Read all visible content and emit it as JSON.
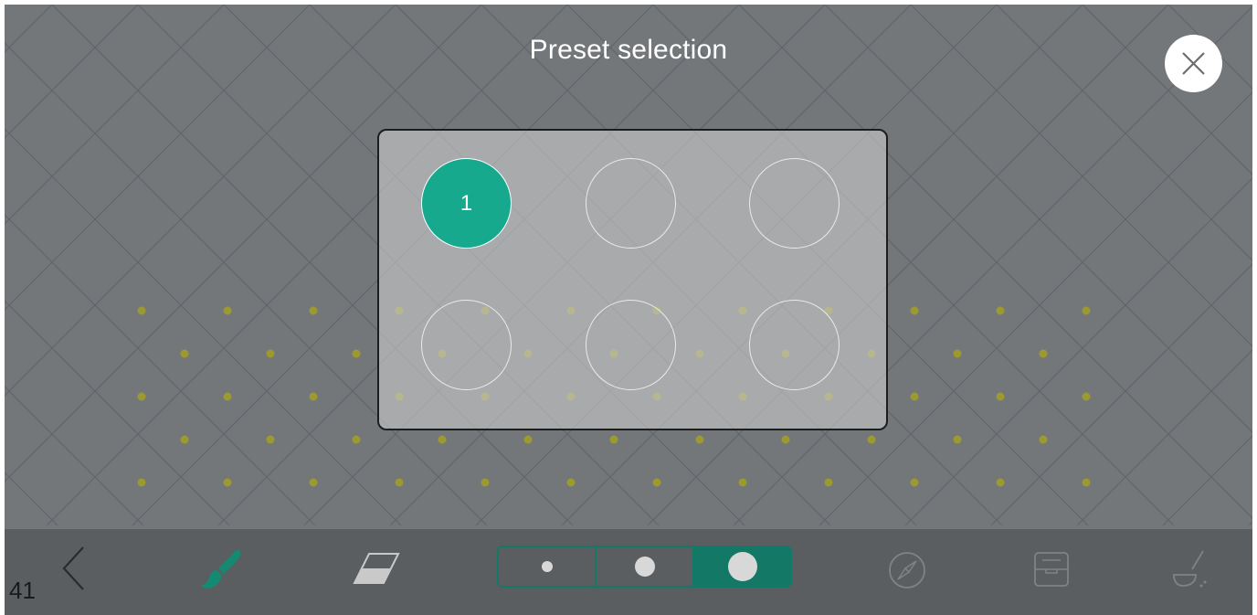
{
  "dialog": {
    "title": "Preset selection",
    "close_icon": "close-icon"
  },
  "presets": {
    "slots": [
      {
        "label": "1",
        "active": true
      },
      {
        "label": "",
        "active": false
      },
      {
        "label": "",
        "active": false
      },
      {
        "label": "",
        "active": false
      },
      {
        "label": "",
        "active": false
      },
      {
        "label": "",
        "active": false
      }
    ]
  },
  "toolbar": {
    "page_number": "41",
    "icons": [
      "back-chevron-icon",
      "paintbrush-icon",
      "eraser-icon",
      "compass-icon",
      "archive-box-icon",
      "broom-icon"
    ],
    "brush_sizes": [
      "small",
      "medium",
      "large"
    ],
    "selected_size": "large"
  },
  "colors": {
    "background": "#73777a",
    "accent": "#17a98e",
    "accent_dark": "#137966",
    "toolbar": "#5b5e61",
    "dots": "#9c9a2e"
  }
}
